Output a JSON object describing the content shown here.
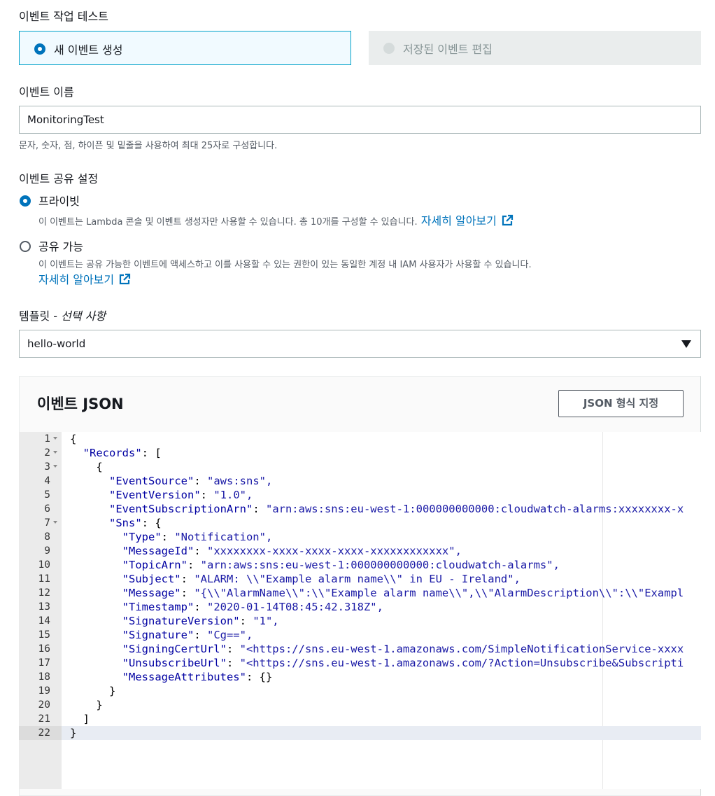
{
  "event_test": {
    "label": "이벤트 작업 테스트",
    "option_new": "새 이벤트 생성",
    "option_saved": "저장된 이벤트 편집"
  },
  "event_name": {
    "label": "이벤트 이름",
    "value": "MonitoringTest",
    "hint": "문자, 숫자, 점, 하이픈 및 밑줄을 사용하여 최대 25자로 구성합니다."
  },
  "sharing": {
    "label": "이벤트 공유 설정",
    "private_label": "프라이빗",
    "private_desc": "이 이벤트는 Lambda 콘솔 및 이벤트 생성자만 사용할 수 있습니다. 총 10개를 구성할 수 있습니다.",
    "shareable_label": "공유 가능",
    "shareable_desc": "이 이벤트는 공유 가능한 이벤트에 액세스하고 이를 사용할 수 있는 권한이 있는 동일한 계정 내 IAM 사용자가 사용할 수 있습니다.",
    "learn_more": "자세히 알아보기"
  },
  "template": {
    "label_main": "템플릿",
    "label_sep": " - ",
    "label_optional": "선택 사항",
    "selected": "hello-world"
  },
  "event_json": {
    "title": "이벤트 JSON",
    "format_button": "JSON 형식 지정",
    "lines": [
      "{",
      "  \"Records\": [",
      "    {",
      "      \"EventSource\": \"aws:sns\",",
      "      \"EventVersion\": \"1.0\",",
      "      \"EventSubscriptionArn\": \"arn:aws:sns:eu-west-1:000000000000:cloudwatch-alarms:xxxxxxxx-x",
      "      \"Sns\": {",
      "        \"Type\": \"Notification\",",
      "        \"MessageId\": \"xxxxxxxx-xxxx-xxxx-xxxx-xxxxxxxxxxxx\",",
      "        \"TopicArn\": \"arn:aws:sns:eu-west-1:000000000000:cloudwatch-alarms\",",
      "        \"Subject\": \"ALARM: \\\\\"Example alarm name\\\\\" in EU - Ireland\",",
      "        \"Message\": \"{\\\\\"AlarmName\\\\\":\\\\\"Example alarm name\\\\\",\\\\\"AlarmDescription\\\\\":\\\\\"Exampl",
      "        \"Timestamp\": \"2020-01-14T08:45:42.318Z\",",
      "        \"SignatureVersion\": \"1\",",
      "        \"Signature\": \"Cg==\",",
      "        \"SigningCertUrl\": \"<https://sns.eu-west-1.amazonaws.com/SimpleNotificationService-xxxx",
      "        \"UnsubscribeUrl\": \"<https://sns.eu-west-1.amazonaws.com/?Action=Unsubscribe&Subscripti",
      "        \"MessageAttributes\": {}",
      "      }",
      "    }",
      "  ]",
      "}"
    ],
    "line_numbers": [
      "1",
      "2",
      "3",
      "4",
      "5",
      "6",
      "7",
      "8",
      "9",
      "10",
      "11",
      "12",
      "13",
      "14",
      "15",
      "16",
      "17",
      "18",
      "19",
      "20",
      "21",
      "22"
    ],
    "foldable_lines": [
      1,
      2,
      3,
      7
    ],
    "active_line": 22
  },
  "colors": {
    "accent": "#0073bb",
    "selected_tile_bg": "#f1faff",
    "selected_tile_border": "#00a1c9",
    "disabled_bg": "#eaeded"
  }
}
